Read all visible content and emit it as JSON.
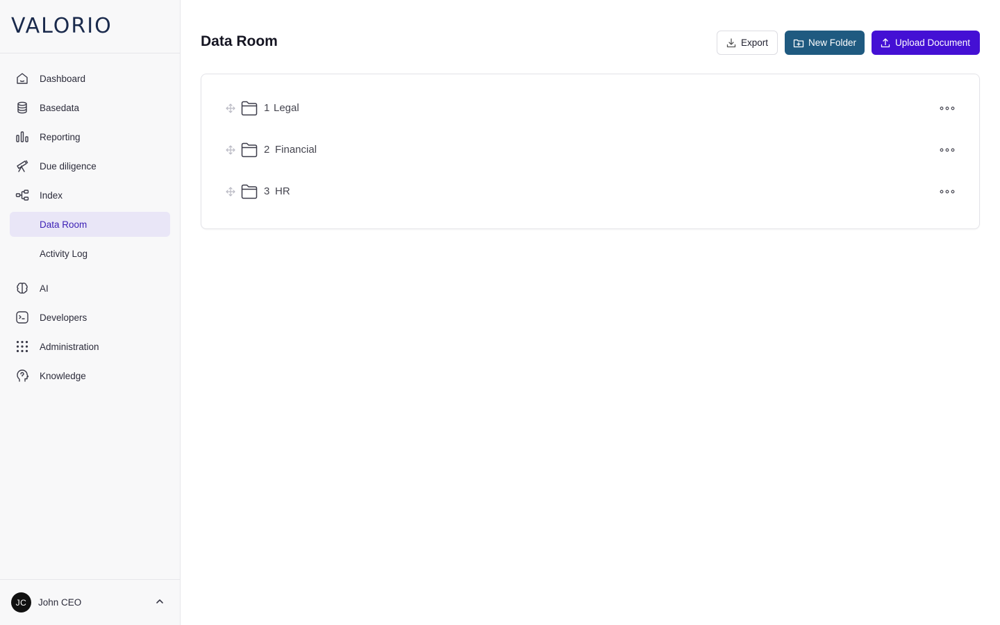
{
  "brand": {
    "logo_text": "VALORIO",
    "accent": "#4a1fd6"
  },
  "sidebar": {
    "items": [
      {
        "label": "Dashboard",
        "icon": "home-icon"
      },
      {
        "label": "Basedata",
        "icon": "database-icon"
      },
      {
        "label": "Reporting",
        "icon": "bar-chart-icon"
      },
      {
        "label": "Due diligence",
        "icon": "telescope-icon"
      },
      {
        "label": "Index",
        "icon": "hierarchy-icon"
      },
      {
        "label": "Data Room",
        "active": true
      },
      {
        "label": "Activity Log"
      },
      {
        "label": "AI",
        "icon": "brain-icon"
      },
      {
        "label": "Developers",
        "icon": "terminal-icon"
      },
      {
        "label": "Administration",
        "icon": "grid-dots-icon"
      },
      {
        "label": "Knowledge",
        "icon": "head-icon"
      }
    ]
  },
  "user": {
    "initials": "JC",
    "name": "John CEO"
  },
  "header": {
    "title": "Data Room",
    "export_label": "Export",
    "new_folder_label": "New Folder",
    "upload_label": "Upload Document"
  },
  "colors": {
    "new_folder_button": "#1f5a80",
    "upload_button": "#4410d4",
    "active_nav_bg": "#e9e6f7"
  },
  "folders": [
    {
      "number": "1",
      "name": "Legal"
    },
    {
      "number": "2",
      "name": "Financial"
    },
    {
      "number": "3",
      "name": "HR"
    }
  ]
}
